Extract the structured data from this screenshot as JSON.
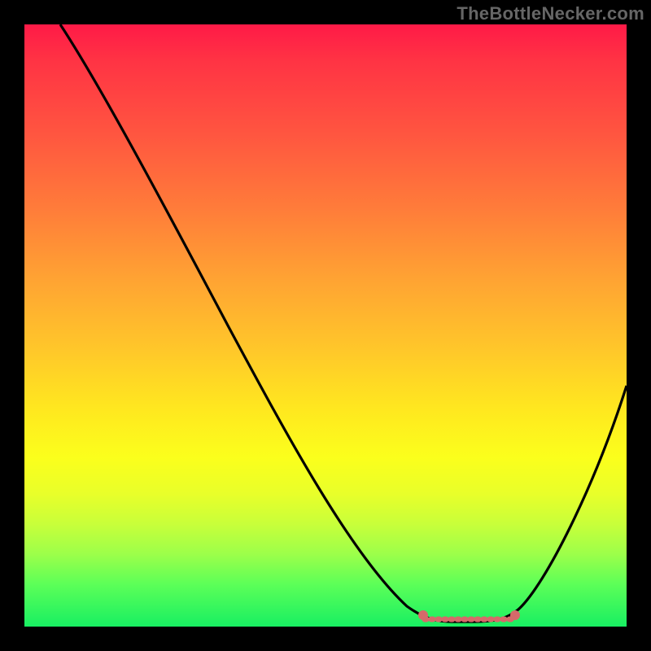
{
  "attribution": "TheBottleNecker.com",
  "chart_data": {
    "type": "line",
    "title": "",
    "xlabel": "",
    "ylabel": "",
    "xlim": [
      0,
      100
    ],
    "ylim": [
      0,
      100
    ],
    "curve": {
      "x": [
        6,
        10,
        14,
        18,
        22,
        26,
        30,
        34,
        38,
        42,
        46,
        50,
        54,
        58,
        62,
        66,
        70,
        74,
        78,
        82,
        86,
        90,
        94,
        98,
        100
      ],
      "y": [
        100,
        94,
        88,
        81,
        74,
        67,
        60,
        53,
        46,
        39,
        32,
        26,
        20,
        14,
        9,
        5,
        2.5,
        1.2,
        1.2,
        2.5,
        6,
        12,
        22,
        34,
        40
      ]
    },
    "highlight_segment": {
      "x_start": 66,
      "x_end": 82,
      "y": 1.5
    },
    "gradient_stops": [
      {
        "pos": 0,
        "color": "#ff1a47"
      },
      {
        "pos": 6,
        "color": "#ff3344"
      },
      {
        "pos": 18,
        "color": "#ff5540"
      },
      {
        "pos": 30,
        "color": "#ff7a3a"
      },
      {
        "pos": 42,
        "color": "#ffa233"
      },
      {
        "pos": 54,
        "color": "#ffc72a"
      },
      {
        "pos": 64,
        "color": "#ffe81f"
      },
      {
        "pos": 72,
        "color": "#fbff1c"
      },
      {
        "pos": 78,
        "color": "#e8ff2a"
      },
      {
        "pos": 83,
        "color": "#c8ff3a"
      },
      {
        "pos": 88,
        "color": "#9cff4a"
      },
      {
        "pos": 93,
        "color": "#5cff58"
      },
      {
        "pos": 100,
        "color": "#18ef62"
      }
    ]
  }
}
